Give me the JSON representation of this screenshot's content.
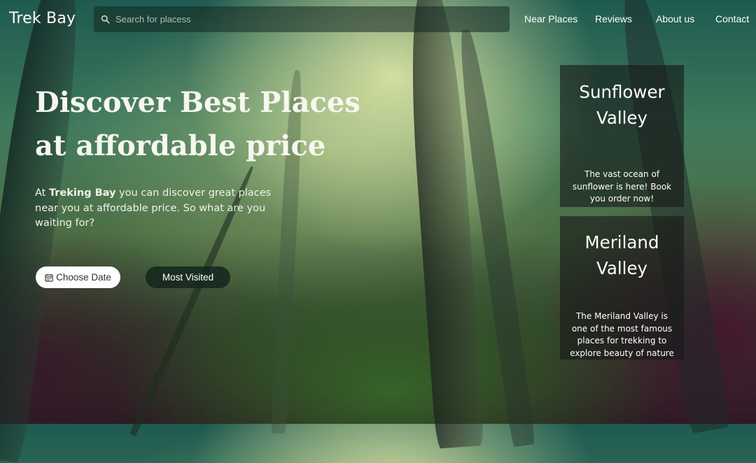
{
  "header": {
    "brand": "Trek Bay",
    "search_placeholder": "Search for placess",
    "nav": [
      "Near Places",
      "Reviews",
      "About us",
      "Contact"
    ]
  },
  "hero": {
    "title_line1": "Discover Best Places",
    "title_line2": "at affordable price",
    "text_before": "At ",
    "text_bold": "Treking Bay",
    "text_after": " you can discover great places near you at affordable price. So what are you waiting for?",
    "choose_date_label": "Choose Date",
    "most_visited_label": "Most Visited"
  },
  "cards": [
    {
      "title_line1": "Sunflower",
      "title_line2": "Valley",
      "description": "The vast ocean of sunflower is here! Book you order now!"
    },
    {
      "title_line1": "Meriland",
      "title_line2": "Valley",
      "description": "The Meriland Valley is one of the most famous places for trekking to explore beauty of nature"
    }
  ],
  "icons": {
    "search": "search-icon",
    "calendar": "calendar-icon"
  }
}
